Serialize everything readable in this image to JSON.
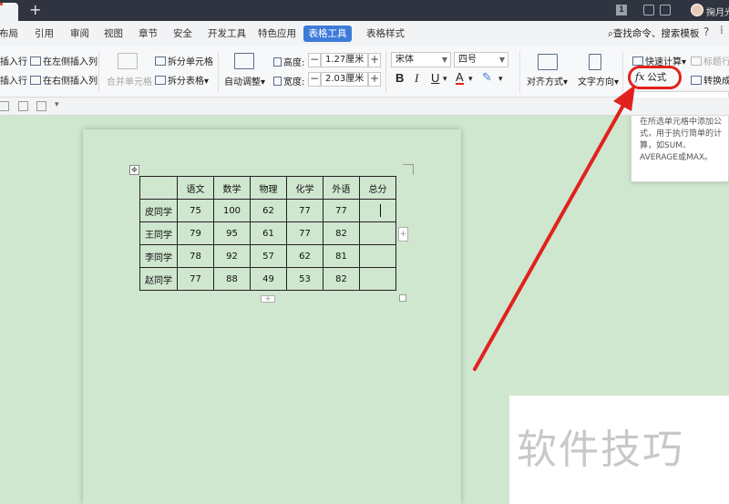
{
  "titlebar": {
    "new_tab": "+",
    "badge": "1",
    "user": "掬月光"
  },
  "menu": {
    "items": [
      "布局",
      "引用",
      "审阅",
      "视图",
      "章节",
      "安全",
      "开发工具",
      "特色应用",
      "表格工具",
      "表格样式"
    ],
    "search": "查找命令、搜索模板",
    "help": "?"
  },
  "ribbon": {
    "insert_row_above": "插入行",
    "insert_row_below": "插入行",
    "insert_col_left": "在左侧插入列",
    "insert_col_right": "在右侧插入列",
    "merge_cells": "合并单元格",
    "split_cells": "拆分单元格",
    "split_table": "拆分表格",
    "auto_fit": "自动调整",
    "height_label": "高度:",
    "height_value": "1.27厘米",
    "width_label": "宽度:",
    "width_value": "2.03厘米",
    "font_name": "宋体",
    "font_size": "四号",
    "bold": "B",
    "italic": "I",
    "underline": "U",
    "font_color": "A",
    "align": "对齐方式",
    "text_direction": "文字方向",
    "quick_calc": "快速计算",
    "title_row": "标题行",
    "formula_fx": "fx",
    "formula": "公式",
    "convert": "转换成"
  },
  "tooltip": {
    "title": "公式",
    "description": "在所选单元格中添加公式，用于执行简单的计算，如SUM、AVERAGE或MAX。"
  },
  "table": {
    "headers": [
      "",
      "语文",
      "数学",
      "物理",
      "化学",
      "外语",
      "总分"
    ],
    "rows": [
      [
        "皮同学",
        "75",
        "100",
        "62",
        "77",
        "77",
        ""
      ],
      [
        "王同学",
        "79",
        "95",
        "61",
        "77",
        "82",
        ""
      ],
      [
        "李同学",
        "78",
        "92",
        "57",
        "62",
        "81",
        ""
      ],
      [
        "赵同学",
        "77",
        "88",
        "49",
        "53",
        "82",
        ""
      ]
    ]
  },
  "watermark": "软件技巧",
  "colors": {
    "accent": "#3d7bd9",
    "annotation": "#e0221c",
    "page_bg": "#cfe6cf"
  }
}
